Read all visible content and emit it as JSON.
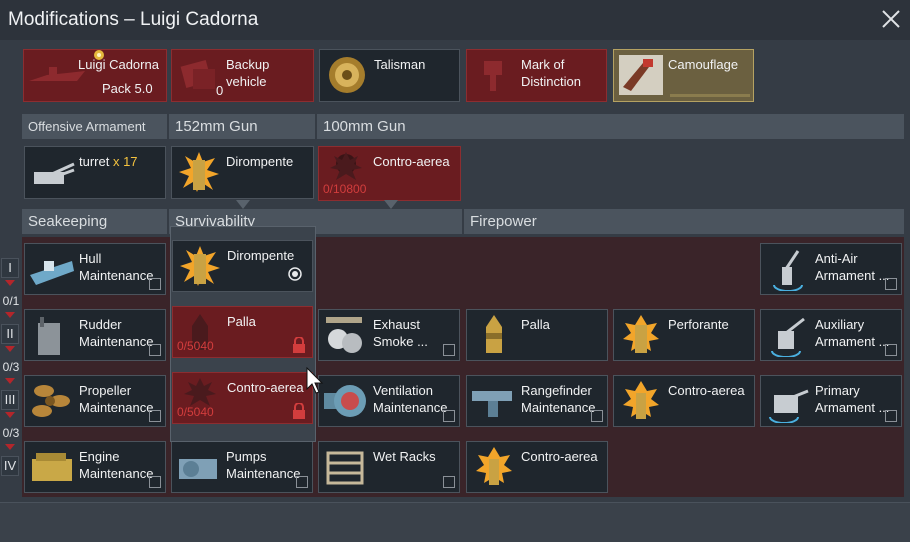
{
  "window": {
    "title": "Modifications – Luigi Cadorna"
  },
  "slots": [
    {
      "label": "Luigi Cadorna",
      "sub": "Pack 5.0"
    },
    {
      "label": "Backup vehicle",
      "count": "0"
    },
    {
      "label": "Talisman"
    },
    {
      "label": "Mark of Distinction"
    },
    {
      "label": "Camouflage"
    }
  ],
  "armament": {
    "headers": [
      "Offensive Armament",
      "152mm Gun",
      "100mm Gun"
    ],
    "turret_label": "turret",
    "turret_count": "x 17",
    "gun1_ammo": "Dirompente",
    "gun2_ammo": "Contro-aerea",
    "gun2_progress": "0/10800"
  },
  "categories": [
    "Seakeeping",
    "Survivability",
    "Firepower"
  ],
  "tiers": [
    {
      "numeral": "I",
      "count": "0/1"
    },
    {
      "numeral": "II",
      "count": "0/3"
    },
    {
      "numeral": "III",
      "count": "0/3"
    },
    {
      "numeral": "IV",
      "count": ""
    }
  ],
  "dropdown": {
    "options": [
      {
        "label": "Dirompente",
        "progress": ""
      },
      {
        "label": "Palla",
        "progress": "0/5040"
      },
      {
        "label": "Contro-aerea",
        "progress": "0/5040"
      }
    ]
  },
  "mods": {
    "hull": "Hull Maintenance",
    "rudder": "Rudder Maintenance",
    "propeller": "Propeller Maintenance",
    "engine": "Engine Maintenance",
    "exhaust": "Exhaust Smoke ...",
    "ventilation": "Ventilation Maintenance",
    "pumps": "Pumps Maintenance",
    "wetracks": "Wet Racks",
    "palla": "Palla",
    "perforante": "Perforante",
    "rangefinder": "Rangefinder Maintenance",
    "contro1": "Contro-aerea",
    "contro2": "Contro-aerea",
    "antiair": "Anti-Air Armament ...",
    "auxiliary": "Auxiliary Armament ...",
    "primary": "Primary Armament ..."
  },
  "colors": {
    "accent_red": "#6a1c20",
    "lock_red": "#d23d3d",
    "gold": "#b5a262"
  }
}
